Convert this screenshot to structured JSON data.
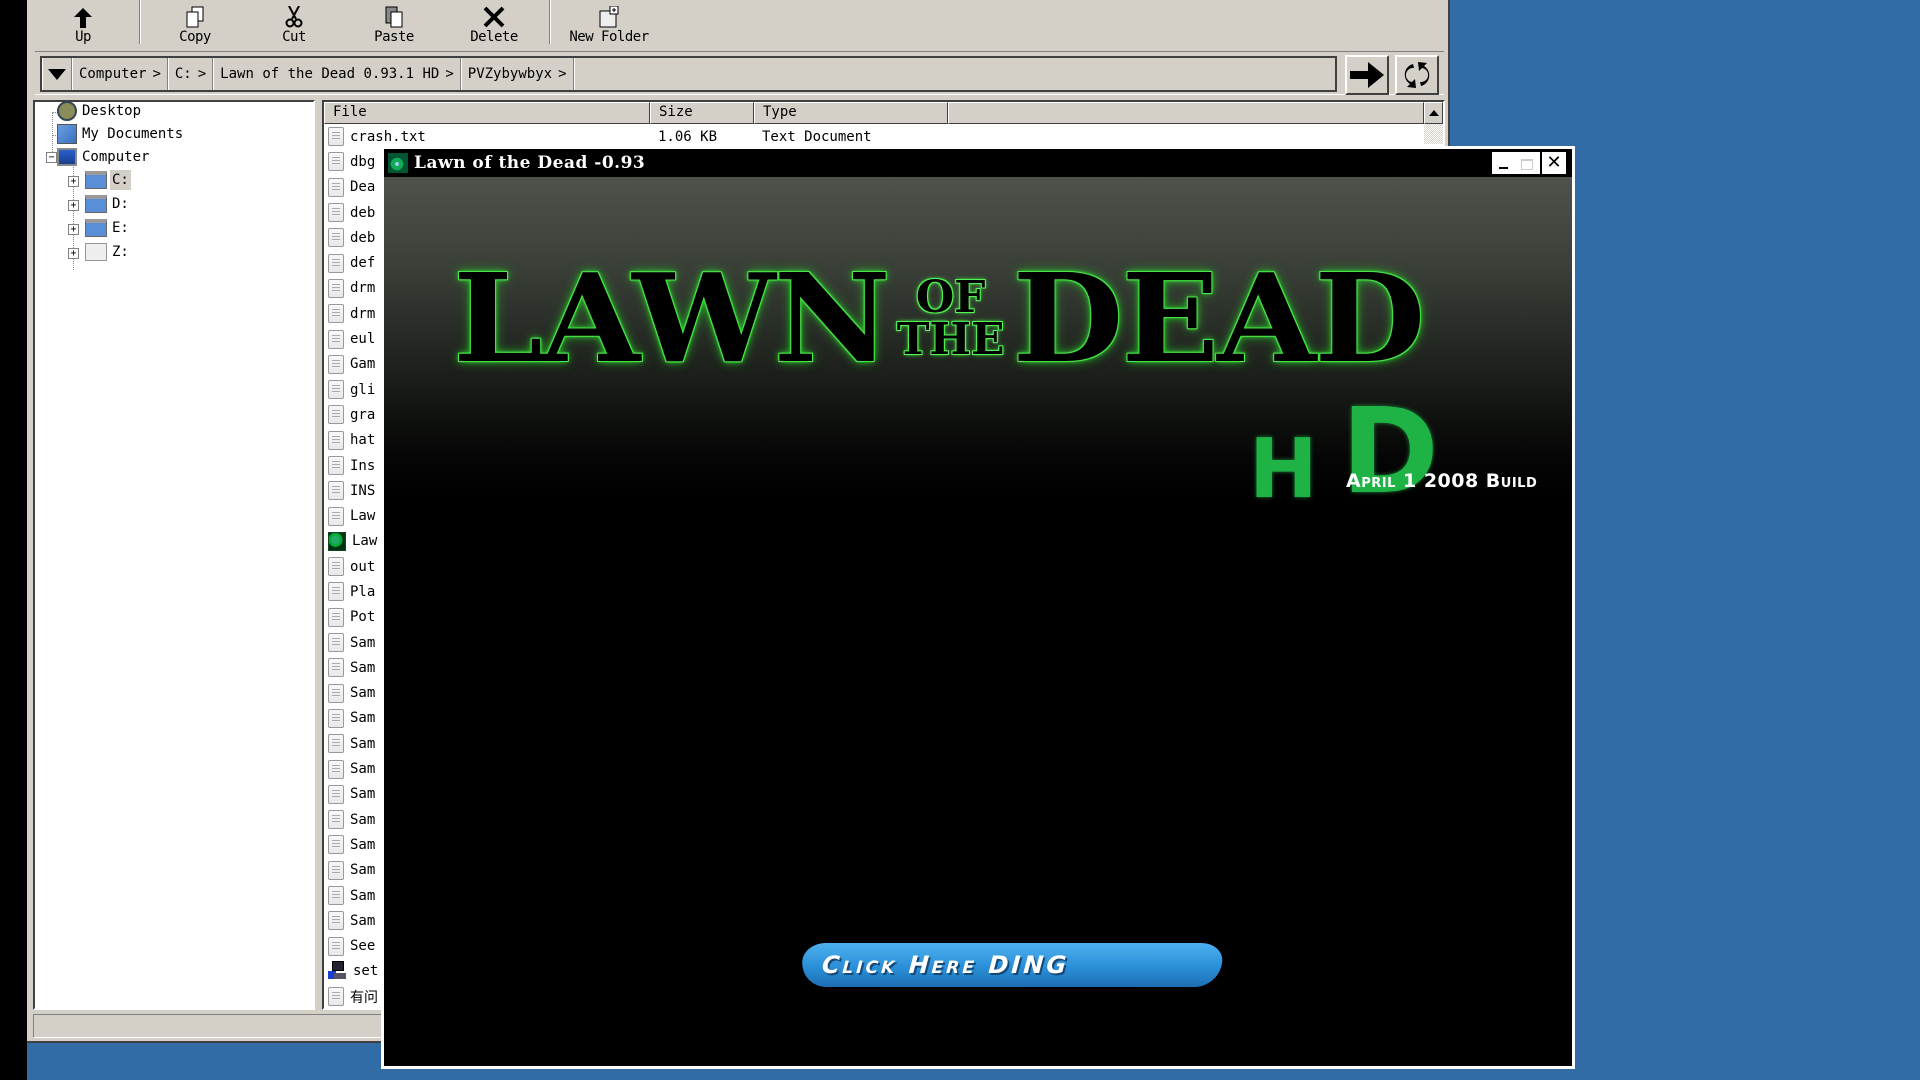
{
  "explorer": {
    "toolbar": [
      {
        "id": "up",
        "label": "Up",
        "icon": "up-arrow-icon"
      },
      {
        "id": "copy",
        "label": "Copy",
        "icon": "copy-icon"
      },
      {
        "id": "cut",
        "label": "Cut",
        "icon": "scissors-icon"
      },
      {
        "id": "paste",
        "label": "Paste",
        "icon": "paste-icon"
      },
      {
        "id": "delete",
        "label": "Delete",
        "icon": "delete-x-icon"
      },
      {
        "id": "new_folder",
        "label": "New Folder",
        "icon": "new-folder-icon"
      }
    ],
    "breadcrumb": [
      "Computer",
      "C:",
      "Lawn of the Dead 0.93.1 HD",
      "PVZybywbyx"
    ],
    "breadcrumb_separator": ">",
    "nav": {
      "go_icon": "go-arrow-icon",
      "refresh_icon": "refresh-icon"
    },
    "tree": {
      "items": [
        {
          "label": "Desktop",
          "icon": "desktop-icon",
          "level": 0
        },
        {
          "label": "My Documents",
          "icon": "my-documents-icon",
          "level": 0
        },
        {
          "label": "Computer",
          "icon": "computer-icon",
          "level": 0,
          "expanded": true
        },
        {
          "label": "C:",
          "icon": "drive-folder-icon",
          "level": 1,
          "selected": true
        },
        {
          "label": "D:",
          "icon": "drive-folder-icon",
          "level": 1
        },
        {
          "label": "E:",
          "icon": "drive-folder-icon",
          "level": 1
        },
        {
          "label": "Z:",
          "icon": "drive-icon",
          "level": 1
        }
      ]
    },
    "columns": [
      "File",
      "Size",
      "Type"
    ],
    "files": [
      {
        "name": "crash.txt",
        "size": "1.06 KB",
        "type": "Text Document",
        "icon": "doc"
      },
      {
        "name": "dbg",
        "icon": "doc"
      },
      {
        "name": "Dea",
        "icon": "doc"
      },
      {
        "name": "deb",
        "icon": "doc"
      },
      {
        "name": "deb",
        "icon": "doc"
      },
      {
        "name": "def",
        "icon": "doc"
      },
      {
        "name": "drm",
        "icon": "doc"
      },
      {
        "name": "drm",
        "icon": "doc"
      },
      {
        "name": "eul",
        "icon": "doc"
      },
      {
        "name": "Gam",
        "icon": "doc"
      },
      {
        "name": "gli",
        "icon": "doc"
      },
      {
        "name": "gra",
        "icon": "doc"
      },
      {
        "name": "hat",
        "icon": "doc"
      },
      {
        "name": "Ins",
        "icon": "doc"
      },
      {
        "name": "INS",
        "icon": "doc"
      },
      {
        "name": "Law",
        "icon": "doc"
      },
      {
        "name": "Law",
        "icon": "exe"
      },
      {
        "name": "out",
        "icon": "doc"
      },
      {
        "name": "Pla",
        "icon": "doc"
      },
      {
        "name": "Pot",
        "icon": "doc"
      },
      {
        "name": "Sam",
        "icon": "doc"
      },
      {
        "name": "Sam",
        "icon": "doc"
      },
      {
        "name": "Sam",
        "icon": "doc"
      },
      {
        "name": "Sam",
        "icon": "doc"
      },
      {
        "name": "Sam",
        "icon": "doc"
      },
      {
        "name": "Sam",
        "icon": "doc"
      },
      {
        "name": "Sam",
        "icon": "doc"
      },
      {
        "name": "Sam",
        "icon": "doc"
      },
      {
        "name": "Sam",
        "icon": "doc"
      },
      {
        "name": "Sam",
        "icon": "doc"
      },
      {
        "name": "Sam",
        "icon": "doc"
      },
      {
        "name": "Sam",
        "icon": "doc"
      },
      {
        "name": "See",
        "icon": "doc"
      },
      {
        "name": "set",
        "icon": "setup"
      },
      {
        "name": "有问",
        "icon": "doc"
      }
    ],
    "status_text": ""
  },
  "game": {
    "title": "Lawn of the Dead -0.93",
    "logo": {
      "word1": "LAWN",
      "of": "OF",
      "the": "THE",
      "word2": "DEAD",
      "hd_h": "H",
      "hd_d": "D"
    },
    "build_text": "April 1 2008 Build",
    "button_label": "Click Here DING",
    "colors": {
      "logo_glow": "#4fe04f",
      "hd": "#1fb346",
      "button": "#2a8fd8"
    }
  }
}
